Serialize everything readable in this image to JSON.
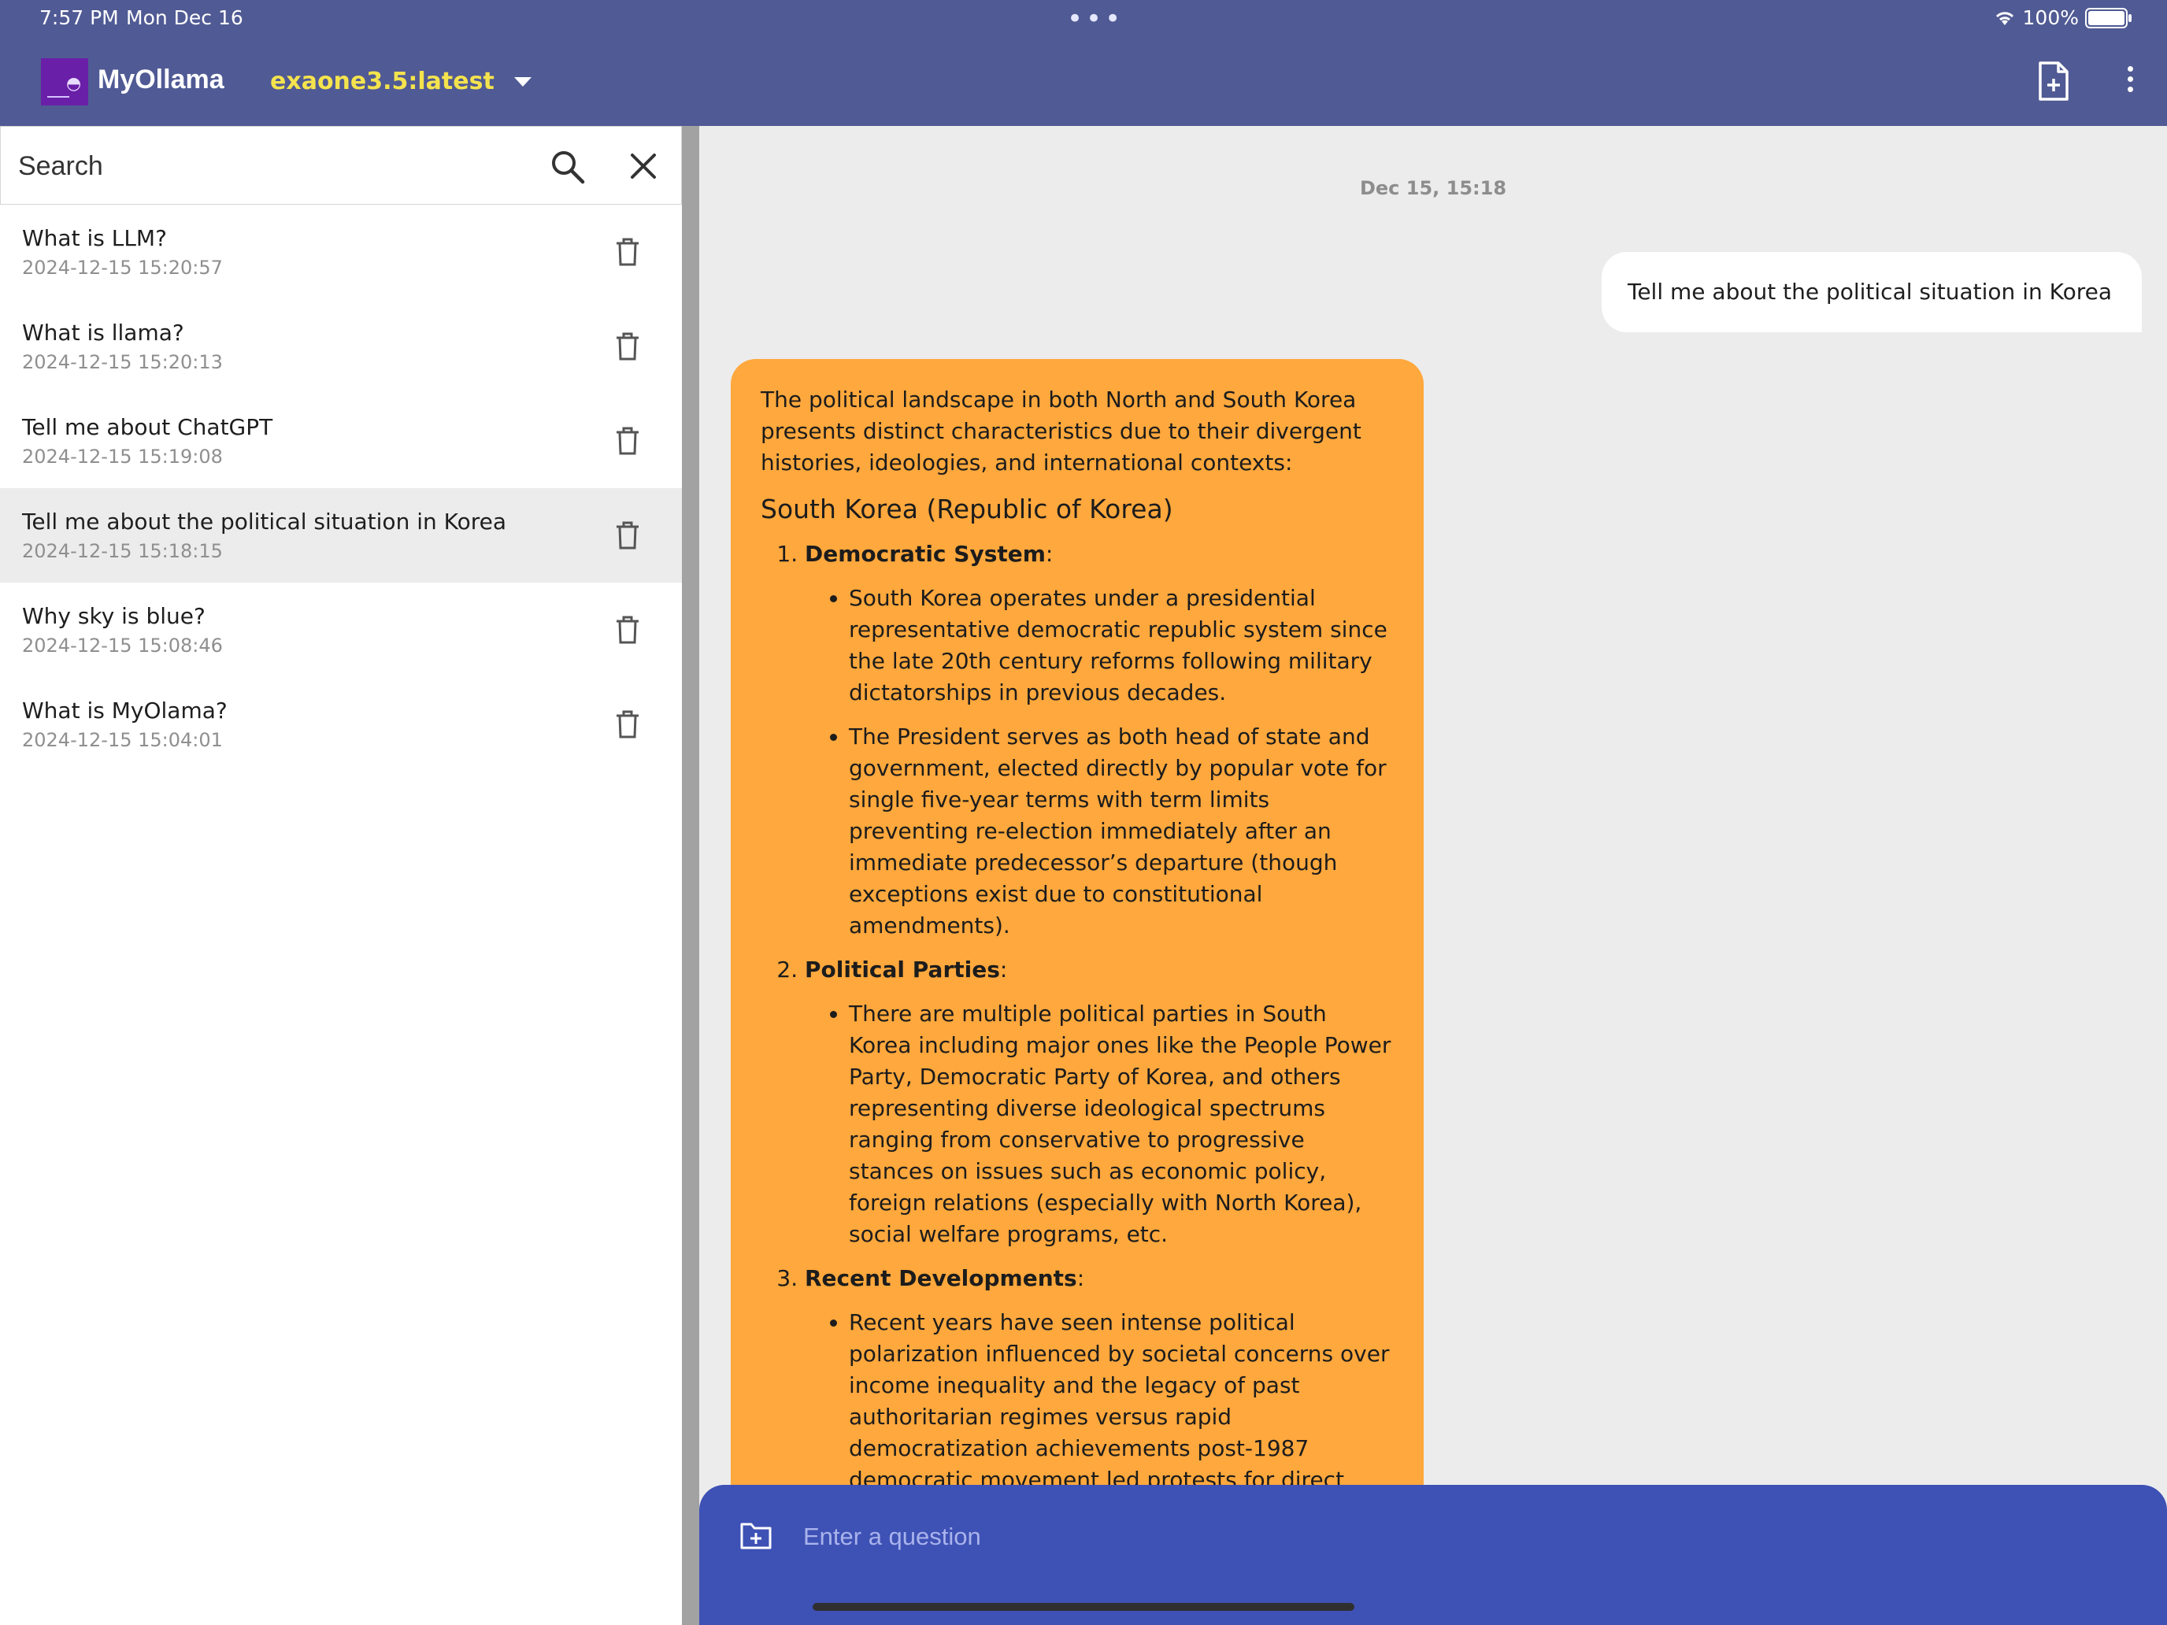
{
  "status": {
    "time": "7:57 PM",
    "date": "Mon Dec 16",
    "battery_percent": "100%",
    "battery_level": 1.0,
    "multitask_dots": "•••"
  },
  "header": {
    "app_title": "MyOllama",
    "model_name": "exaone3.5:latest"
  },
  "search": {
    "placeholder": "Search"
  },
  "history": [
    {
      "title": "What is LLM?",
      "date": "2024-12-15 15:20:57",
      "active": false
    },
    {
      "title": "What is llama?",
      "date": "2024-12-15 15:20:13",
      "active": false
    },
    {
      "title": "Tell me about ChatGPT",
      "date": "2024-12-15 15:19:08",
      "active": false
    },
    {
      "title": "Tell me about the political situation in Korea",
      "date": "2024-12-15 15:18:15",
      "active": true
    },
    {
      "title": "Why sky is blue?",
      "date": "2024-12-15 15:08:46",
      "active": false
    },
    {
      "title": "What is MyOlama?",
      "date": "2024-12-15 15:04:01",
      "active": false
    }
  ],
  "chat": {
    "timestamp": "Dec 15, 15:18",
    "user_message": "Tell me about the political situation in Korea",
    "bot": {
      "intro": "The political landscape in both North and South Korea presents distinct characteristics due to their divergent histories, ideologies, and international contexts:",
      "heading": "South Korea (Republic of Korea)",
      "sections": [
        {
          "title": "Democratic System",
          "bullets": [
            "South Korea operates under a presidential representative democratic republic system since the late 20th century reforms following military dictatorships in previous decades.",
            "The President serves as both head of state and government, elected directly by popular vote for single five-year terms with term limits preventing re-election immediately after an immediate predecessor’s departure (though exceptions exist due to constitutional amendments)."
          ]
        },
        {
          "title": "Political Parties",
          "bullets": [
            "There are multiple political parties in South Korea including major ones like the People Power Party, Democratic Party of Korea, and others representing diverse ideological spectrums ranging from conservative to progressive stances on issues such as economic policy, foreign relations (especially with North Korea), social welfare programs, etc."
          ]
        },
        {
          "title": "Recent Developments",
          "bullets": [
            "Recent years have seen intense political polarization influenced by societal concerns over income inequality and the legacy of past authoritarian regimes versus rapid democratization achievements post-1987 democratic movement led protests for direct elections (June Democracy Movement)."
          ]
        }
      ]
    }
  },
  "composer": {
    "placeholder": "Enter a question"
  },
  "icons": {
    "new_chat": "new-document-icon",
    "more": "more-vert-icon",
    "search": "search-icon",
    "clear": "close-icon",
    "delete": "trash-icon",
    "attach": "folder-add-icon"
  },
  "colors": {
    "app_bar": "#505a94",
    "model_name": "#f4e34d",
    "bot_bubble": "#ffa83d",
    "composer": "#3e51b5",
    "logo": "#6a1fa8"
  }
}
